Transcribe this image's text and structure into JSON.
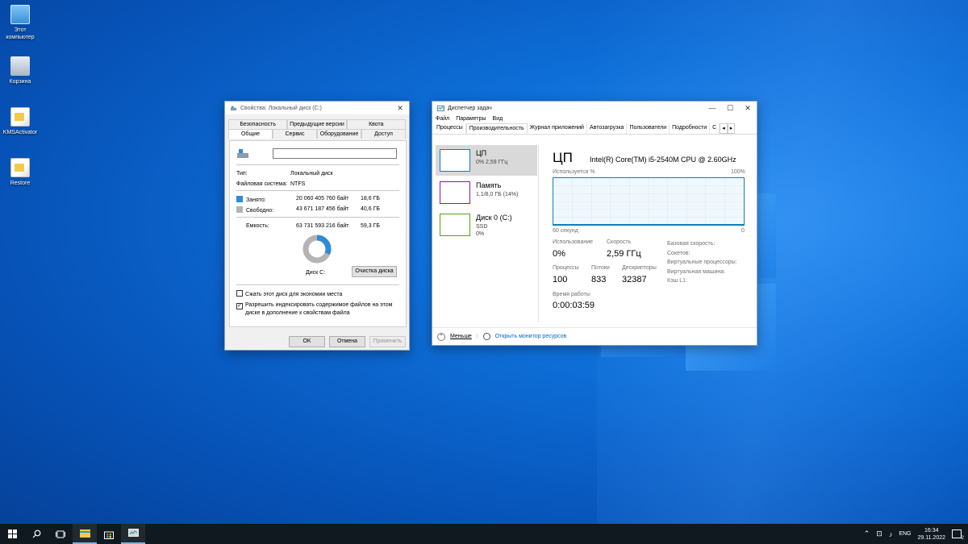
{
  "desktop": {
    "icons": [
      {
        "label_line1": "Этот",
        "label_line2": "компьютер",
        "icon": "computer-icon"
      },
      {
        "label": "Корзина",
        "icon": "recycle-bin-icon"
      },
      {
        "label": "KMSActivator",
        "icon": "file-icon"
      },
      {
        "label": "Restore",
        "icon": "file-icon"
      }
    ]
  },
  "props": {
    "title": "Свойства: Локальный диск (C:)",
    "tabs_back": [
      "Безопасность",
      "Предыдущие версии",
      "Квота"
    ],
    "tabs_front": [
      "Общие",
      "Сервис",
      "Оборудование",
      "Доступ"
    ],
    "name_value": "",
    "type_label": "Тип:",
    "type_value": "Локальный диск",
    "fs_label": "Файловая система:",
    "fs_value": "NTFS",
    "used_label": "Занято:",
    "used_bytes": "20 060 405 760 байт",
    "used_gb": "18,6 ГБ",
    "free_label": "Свободно:",
    "free_bytes": "43 671 187 456 байт",
    "free_gb": "40,6 ГБ",
    "cap_label": "Емкость:",
    "cap_bytes": "63 731 593 216 байт",
    "cap_gb": "59,3 ГБ",
    "used_fraction": 0.315,
    "colors": {
      "used": "#2e8bd6",
      "free": "#b4b4b4"
    },
    "disk_label": "Диск С:",
    "cleanup_button": "Очистка диска",
    "compress_label": "Сжать этот диск для экономии места",
    "compress_checked": false,
    "index_label_1": "Разрешить индексировать содержимое файлов на этом",
    "index_label_2": "диске в дополнение к свойствам файла",
    "index_checked": true,
    "ok": "OK",
    "cancel": "Отмена",
    "apply": "Применить"
  },
  "taskmgr": {
    "title": "Диспетчер задач",
    "menu": [
      "Файл",
      "Параметры",
      "Вид"
    ],
    "tabs": [
      "Процессы",
      "Производительность",
      "Журнал приложений",
      "Автозагрузка",
      "Пользователи",
      "Подробности",
      "С"
    ],
    "active_tab": 1,
    "sidebar": [
      {
        "name": "ЦП",
        "sub1": "0%  2,59 ГГц",
        "sub2": "",
        "color": "#117dbb"
      },
      {
        "name": "Память",
        "sub1": "1,1/8,0 ГБ (14%)",
        "sub2": "",
        "color": "#8b12ae"
      },
      {
        "name": "Диск 0 (C:)",
        "sub1": "SSD",
        "sub2": "0%",
        "color": "#4da60c"
      }
    ],
    "heading": "ЦП",
    "cpu_model": "Intel(R) Core(TM) i5-2540M CPU @ 2.60GHz",
    "graph_label": "Используется %",
    "graph_max": "100%",
    "graph_time": "60 секунд",
    "graph_min": "0",
    "stats": {
      "usage_label": "Использование",
      "usage": "0%",
      "speed_label": "Скорость",
      "speed": "2,59 ГГц",
      "proc_label": "Процессы",
      "proc": "100",
      "threads_label": "Потоки",
      "threads": "833",
      "handles_label": "Дескрипторы",
      "handles": "32387",
      "uptime_label": "Время работы",
      "uptime": "0:00:03:59"
    },
    "right_labels": [
      "Базовая скорость:",
      "Сокетов:",
      "Виртуальные процессоры:",
      "Виртуальная машина:",
      "Кэш L1:"
    ],
    "less": "Меньше",
    "monitor": "Открыть монитор ресурсов"
  },
  "taskbar": {
    "lang": "ENG",
    "time": "16:34",
    "date": "29.11.2022",
    "notif_count": "2"
  }
}
